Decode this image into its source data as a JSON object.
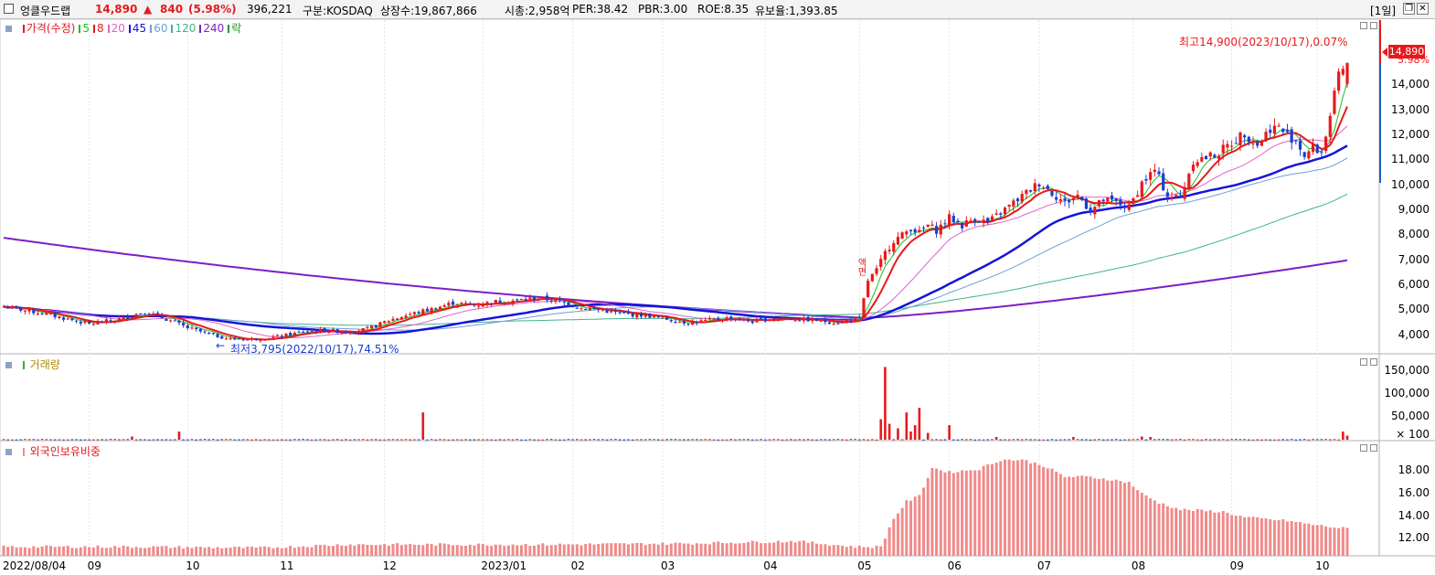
{
  "header": {
    "stock_name": "엉클우드랩",
    "price": "14,890",
    "change_arrow": "▲",
    "change": "840",
    "change_pct": "(5.98%)",
    "volume": "396,221",
    "market": "구분:KOSDAQ",
    "shares": "상장수:19,867,866",
    "market_cap": "시총:2,958억",
    "per": "PER:38.42",
    "pbr": "PBR:3.00",
    "roe": "ROE:8.35",
    "float_ratio": "유보율:1,393.85",
    "period": "[1일]",
    "restore_icon": "restore-icon",
    "close_icon": "close-icon"
  },
  "colors": {
    "up": "#e8191c",
    "down": "#1b3fd1",
    "ma5": "#1fbe1f",
    "ma8": "#e8191c",
    "ma20": "#e062c8",
    "ma45": "#1414d8",
    "ma60": "#6e9fd8",
    "ma120": "#3fb58a",
    "ma240": "#7b1fc8",
    "foreign": "#f08a8a"
  },
  "price_legend": {
    "series": [
      {
        "label": "가격(수정)",
        "color": "#e8191c"
      },
      {
        "label": "5",
        "color": "#1fbe1f"
      },
      {
        "label": "8",
        "color": "#e8191c"
      },
      {
        "label": "20",
        "color": "#e062c8"
      },
      {
        "label": "45",
        "color": "#1414d8"
      },
      {
        "label": "60",
        "color": "#6e9fd8"
      },
      {
        "label": "120",
        "color": "#3fb58a"
      },
      {
        "label": "240",
        "color": "#7b1fc8"
      },
      {
        "label": "락",
        "color": "#1f9a1f"
      }
    ]
  },
  "annotations": {
    "high": "최고14,900(2023/10/17),0.07%",
    "low": "최저3,795(2022/10/17),74.51%",
    "current_price": "14,890",
    "current_pct": "5.98%",
    "event": "액면"
  },
  "volume_legend": {
    "label": "거래량"
  },
  "foreign_legend": {
    "label": "외국인보유비중"
  },
  "chart_data": [
    {
      "type": "candlestick",
      "ylim": [
        3300,
        16600
      ],
      "yticks": [
        "4,000",
        "5,000",
        "6,000",
        "7,000",
        "8,000",
        "9,000",
        "10,000",
        "11,000",
        "12,000",
        "13,000",
        "14,000"
      ],
      "yticks_values": [
        4000,
        5000,
        6000,
        7000,
        8000,
        9000,
        10000,
        11000,
        12000,
        13000,
        14000
      ],
      "x_labels": [
        "2022/08/04",
        "09",
        "10",
        "11",
        "12",
        "2023/01",
        "02",
        "03",
        "04",
        "05",
        "06",
        "07",
        "08",
        "09",
        "10"
      ],
      "x_label_days": [
        0,
        20,
        43,
        65,
        89,
        112,
        133,
        154,
        178,
        200,
        221,
        242,
        264,
        287,
        307
      ],
      "days": 315,
      "anchors": [
        [
          0,
          5150
        ],
        [
          10,
          4850
        ],
        [
          20,
          4450
        ],
        [
          27,
          4650
        ],
        [
          33,
          4950
        ],
        [
          38,
          4650
        ],
        [
          43,
          4300
        ],
        [
          48,
          4050
        ],
        [
          53,
          3850
        ],
        [
          58,
          3850
        ],
        [
          62,
          3900
        ],
        [
          66,
          4000
        ],
        [
          70,
          4150
        ],
        [
          75,
          4200
        ],
        [
          80,
          4150
        ],
        [
          85,
          4250
        ],
        [
          90,
          4600
        ],
        [
          95,
          4850
        ],
        [
          100,
          5050
        ],
        [
          105,
          5300
        ],
        [
          110,
          5200
        ],
        [
          115,
          5350
        ],
        [
          120,
          5400
        ],
        [
          125,
          5500
        ],
        [
          130,
          5350
        ],
        [
          135,
          5100
        ],
        [
          140,
          5000
        ],
        [
          145,
          4850
        ],
        [
          150,
          4800
        ],
        [
          155,
          4650
        ],
        [
          160,
          4500
        ],
        [
          165,
          4600
        ],
        [
          170,
          4700
        ],
        [
          175,
          4550
        ],
        [
          180,
          4700
        ],
        [
          185,
          4650
        ],
        [
          190,
          4600
        ],
        [
          195,
          4500
        ],
        [
          198,
          4650
        ],
        [
          200,
          4650
        ],
        [
          202,
          6200
        ],
        [
          204,
          6600
        ],
        [
          206,
          7300
        ],
        [
          208,
          7800
        ],
        [
          210,
          8000
        ],
        [
          212,
          8300
        ],
        [
          214,
          8100
        ],
        [
          216,
          8400
        ],
        [
          218,
          8200
        ],
        [
          221,
          8700
        ],
        [
          224,
          8400
        ],
        [
          227,
          8700
        ],
        [
          230,
          8500
        ],
        [
          233,
          8900
        ],
        [
          236,
          9300
        ],
        [
          239,
          9700
        ],
        [
          242,
          10100
        ],
        [
          245,
          9700
        ],
        [
          248,
          9300
        ],
        [
          251,
          9600
        ],
        [
          254,
          9000
        ],
        [
          257,
          9400
        ],
        [
          260,
          9300
        ],
        [
          263,
          9100
        ],
        [
          266,
          10100
        ],
        [
          269,
          10600
        ],
        [
          272,
          9600
        ],
        [
          275,
          9500
        ],
        [
          278,
          11000
        ],
        [
          281,
          11100
        ],
        [
          284,
          11300
        ],
        [
          287,
          11700
        ],
        [
          290,
          12100
        ],
        [
          293,
          11600
        ],
        [
          296,
          12300
        ],
        [
          298,
          12300
        ],
        [
          300,
          12000
        ],
        [
          302,
          11800
        ],
        [
          304,
          11200
        ],
        [
          306,
          11500
        ],
        [
          308,
          11300
        ],
        [
          310,
          12800
        ],
        [
          312,
          14300
        ],
        [
          314,
          14890
        ]
      ],
      "ma_finals": {
        "ma20": 12800,
        "ma45": 11500,
        "ma60": 11000,
        "ma120": 9400,
        "ma240": 7000
      },
      "ma240_start": 7900
    },
    {
      "type": "bar",
      "name": "거래량",
      "ylim": [
        0,
        175000
      ],
      "yticks": [
        "50,000",
        "100,000",
        "150,000"
      ],
      "yticks_values": [
        50000,
        100000,
        150000
      ],
      "unit": "× 100",
      "spikes": [
        [
          30,
          7000
        ],
        [
          41,
          18000
        ],
        [
          98,
          60000
        ],
        [
          205,
          45000
        ],
        [
          206,
          160000
        ],
        [
          207,
          35000
        ],
        [
          209,
          25000
        ],
        [
          211,
          60000
        ],
        [
          212,
          18000
        ],
        [
          213,
          32000
        ],
        [
          214,
          70000
        ],
        [
          216,
          15000
        ],
        [
          221,
          32000
        ],
        [
          232,
          6000
        ],
        [
          250,
          6000
        ],
        [
          266,
          7000
        ],
        [
          268,
          6000
        ],
        [
          313,
          18000
        ],
        [
          314,
          9000
        ]
      ],
      "base": 1200
    },
    {
      "type": "bar",
      "name": "외국인보유비중",
      "ylim": [
        10.5,
        20.3
      ],
      "yticks": [
        "12.00",
        "14.00",
        "16.00",
        "18.00"
      ],
      "yticks_values": [
        12,
        14,
        16,
        18
      ],
      "anchors": [
        [
          0,
          11.3
        ],
        [
          30,
          11.3
        ],
        [
          60,
          11.2
        ],
        [
          80,
          11.5
        ],
        [
          100,
          11.5
        ],
        [
          130,
          11.5
        ],
        [
          160,
          11.6
        ],
        [
          185,
          11.8
        ],
        [
          199,
          11.3
        ],
        [
          205,
          11.3
        ],
        [
          208,
          13.8
        ],
        [
          211,
          15.3
        ],
        [
          214,
          15.8
        ],
        [
          217,
          18.3
        ],
        [
          221,
          17.9
        ],
        [
          228,
          18.2
        ],
        [
          233,
          19.0
        ],
        [
          238,
          19.0
        ],
        [
          243,
          18.5
        ],
        [
          248,
          17.5
        ],
        [
          253,
          17.5
        ],
        [
          258,
          17.3
        ],
        [
          263,
          17.0
        ],
        [
          266,
          16.0
        ],
        [
          270,
          15.2
        ],
        [
          275,
          14.6
        ],
        [
          285,
          14.4
        ],
        [
          290,
          13.9
        ],
        [
          300,
          13.6
        ],
        [
          307,
          13.2
        ],
        [
          314,
          12.9
        ]
      ]
    }
  ],
  "x_axis": {
    "labels": [
      "2022/08/04",
      "09",
      "10",
      "11",
      "12",
      "2023/01",
      "02",
      "03",
      "04",
      "05",
      "06",
      "07",
      "08",
      "09",
      "10"
    ]
  }
}
